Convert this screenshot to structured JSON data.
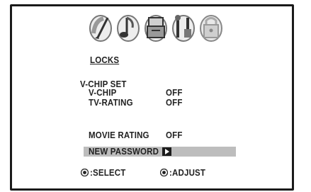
{
  "menu": {
    "title": "LOCKS",
    "vchip_set": "V-CHIP SET",
    "vchip": {
      "label": "V-CHIP",
      "value": "OFF"
    },
    "tv_rating": {
      "label": "TV-RATING",
      "value": "OFF"
    },
    "movie_rating": {
      "label": "MOVIE RATING",
      "value": "OFF"
    },
    "new_password": {
      "label": "NEW PASSWORD"
    }
  },
  "footer": {
    "select": ":SELECT",
    "adjust": ":ADJUST"
  },
  "icons": [
    "palette-icon",
    "music-note-icon",
    "box-icon",
    "tools-icon",
    "lock-icon"
  ],
  "colors": {
    "highlight": "#bdbdbd",
    "text": "#222222",
    "frame": "#1a1a1a"
  }
}
